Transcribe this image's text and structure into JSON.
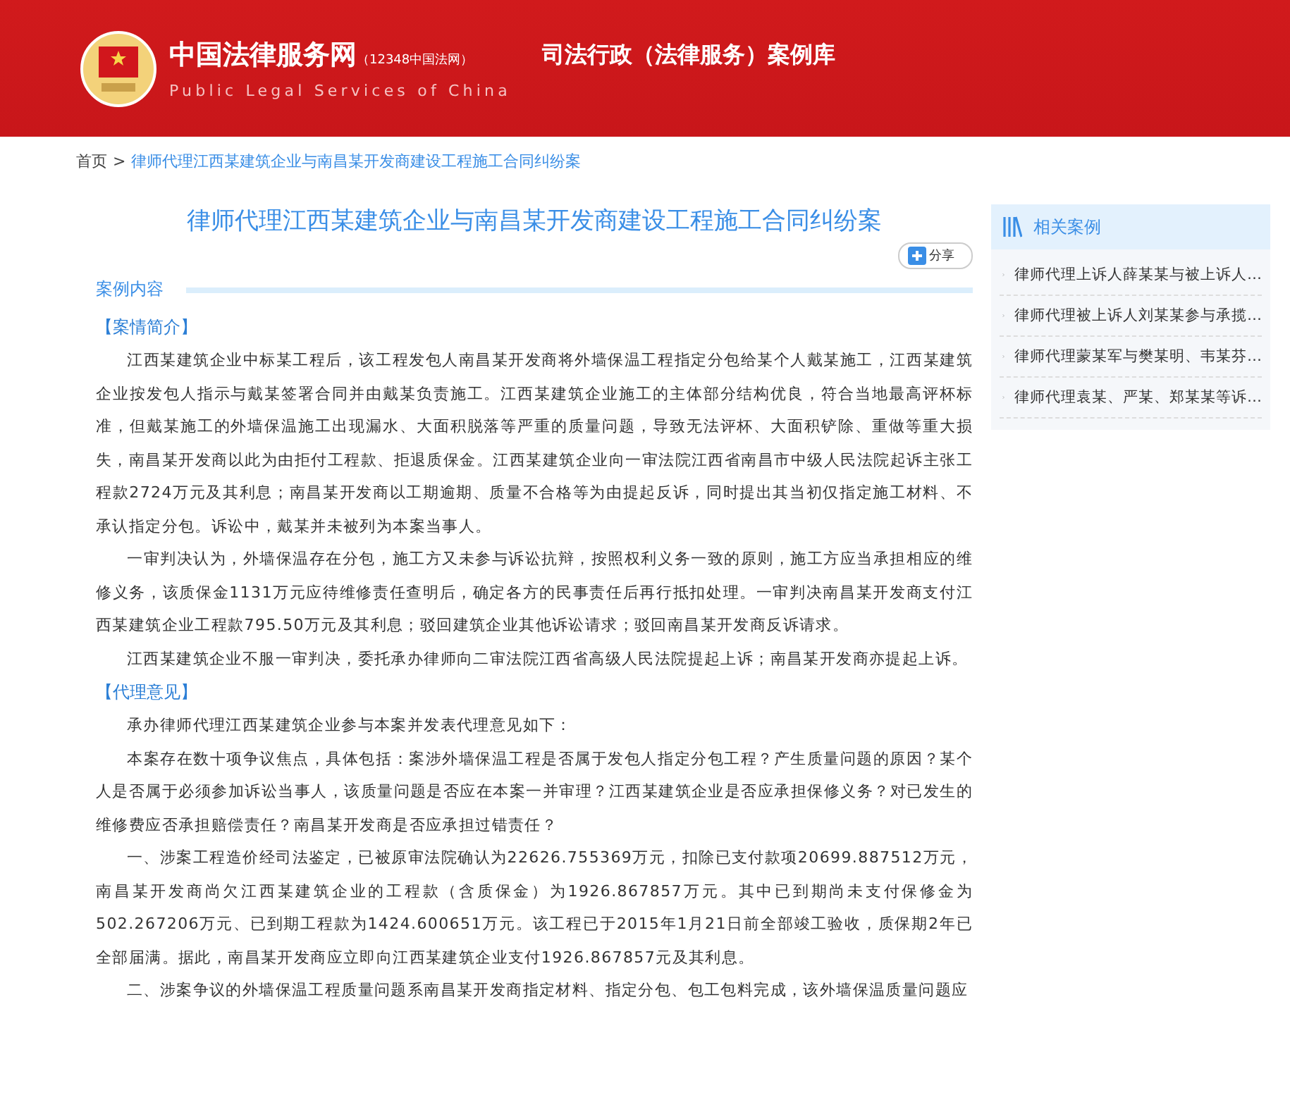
{
  "header": {
    "site_name": "中国法律服务网",
    "site_sub": "（12348中国法网）",
    "site_english": "Public Legal Services of China",
    "section_title": "司法行政（法律服务）案例库"
  },
  "breadcrumb": {
    "home": "首页",
    "separator": ">",
    "current": "律师代理江西某建筑企业与南昌某开发商建设工程施工合同纠纷案"
  },
  "article": {
    "title": "律师代理江西某建筑企业与南昌某开发商建设工程施工合同纠纷案",
    "share_label": "分享",
    "content_heading": "案例内容",
    "blocks": [
      {
        "kind": "heading",
        "text": "【案情简介】"
      },
      {
        "kind": "paragraph",
        "text": "江西某建筑企业中标某工程后，该工程发包人南昌某开发商将外墙保温工程指定分包给某个人戴某施工，江西某建筑企业按发包人指示与戴某签署合同并由戴某负责施工。江西某建筑企业施工的主体部分结构优良，符合当地最高评杯标准，但戴某施工的外墙保温施工出现漏水、大面积脱落等严重的质量问题，导致无法评杯、大面积铲除、重做等重大损失，南昌某开发商以此为由拒付工程款、拒退质保金。江西某建筑企业向一审法院江西省南昌市中级人民法院起诉主张工程款2724万元及其利息；南昌某开发商以工期逾期、质量不合格等为由提起反诉，同时提出其当初仅指定施工材料、不承认指定分包。诉讼中，戴某并未被列为本案当事人。"
      },
      {
        "kind": "paragraph",
        "text": "一审判决认为，外墙保温存在分包，施工方又未参与诉讼抗辩，按照权利义务一致的原则，施工方应当承担相应的维修义务，该质保金1131万元应待维修责任查明后，确定各方的民事责任后再行抵扣处理。一审判决南昌某开发商支付江西某建筑企业工程款795.50万元及其利息；驳回建筑企业其他诉讼请求；驳回南昌某开发商反诉请求。"
      },
      {
        "kind": "paragraph",
        "text": "江西某建筑企业不服一审判决，委托承办律师向二审法院江西省高级人民法院提起上诉；南昌某开发商亦提起上诉。"
      },
      {
        "kind": "heading",
        "text": "【代理意见】"
      },
      {
        "kind": "paragraph",
        "text": "承办律师代理江西某建筑企业参与本案并发表代理意见如下："
      },
      {
        "kind": "paragraph",
        "text": "本案存在数十项争议焦点，具体包括：案涉外墙保温工程是否属于发包人指定分包工程？产生质量问题的原因？某个人是否属于必须参加诉讼当事人，该质量问题是否应在本案一并审理？江西某建筑企业是否应承担保修义务？对已发生的维修费应否承担赔偿责任？南昌某开发商是否应承担过错责任？"
      },
      {
        "kind": "paragraph",
        "text": "一、涉案工程造价经司法鉴定，已被原审法院确认为22626.755369万元，扣除已支付款项20699.887512万元，南昌某开发商尚欠江西某建筑企业的工程款（含质保金）为1926.867857万元。其中已到期尚未支付保修金为502.267206万元、已到期工程款为1424.600651万元。该工程已于2015年1月21日前全部竣工验收，质保期2年已全部届满。据此，南昌某开发商应立即向江西某建筑企业支付1926.867857元及其利息。"
      },
      {
        "kind": "paragraph",
        "text": "二、涉案争议的外墙保温工程质量问题系南昌某开发商指定材料、指定分包、包工包料完成，该外墙保温质量问题应"
      }
    ]
  },
  "sidebar": {
    "title": "相关案例",
    "items": [
      "律师代理上诉人薛某某与被上诉人…",
      "律师代理被上诉人刘某某参与承揽…",
      "律师代理蒙某军与樊某明、韦某芬…",
      "律师代理袁某、严某、郑某某等诉…"
    ]
  }
}
